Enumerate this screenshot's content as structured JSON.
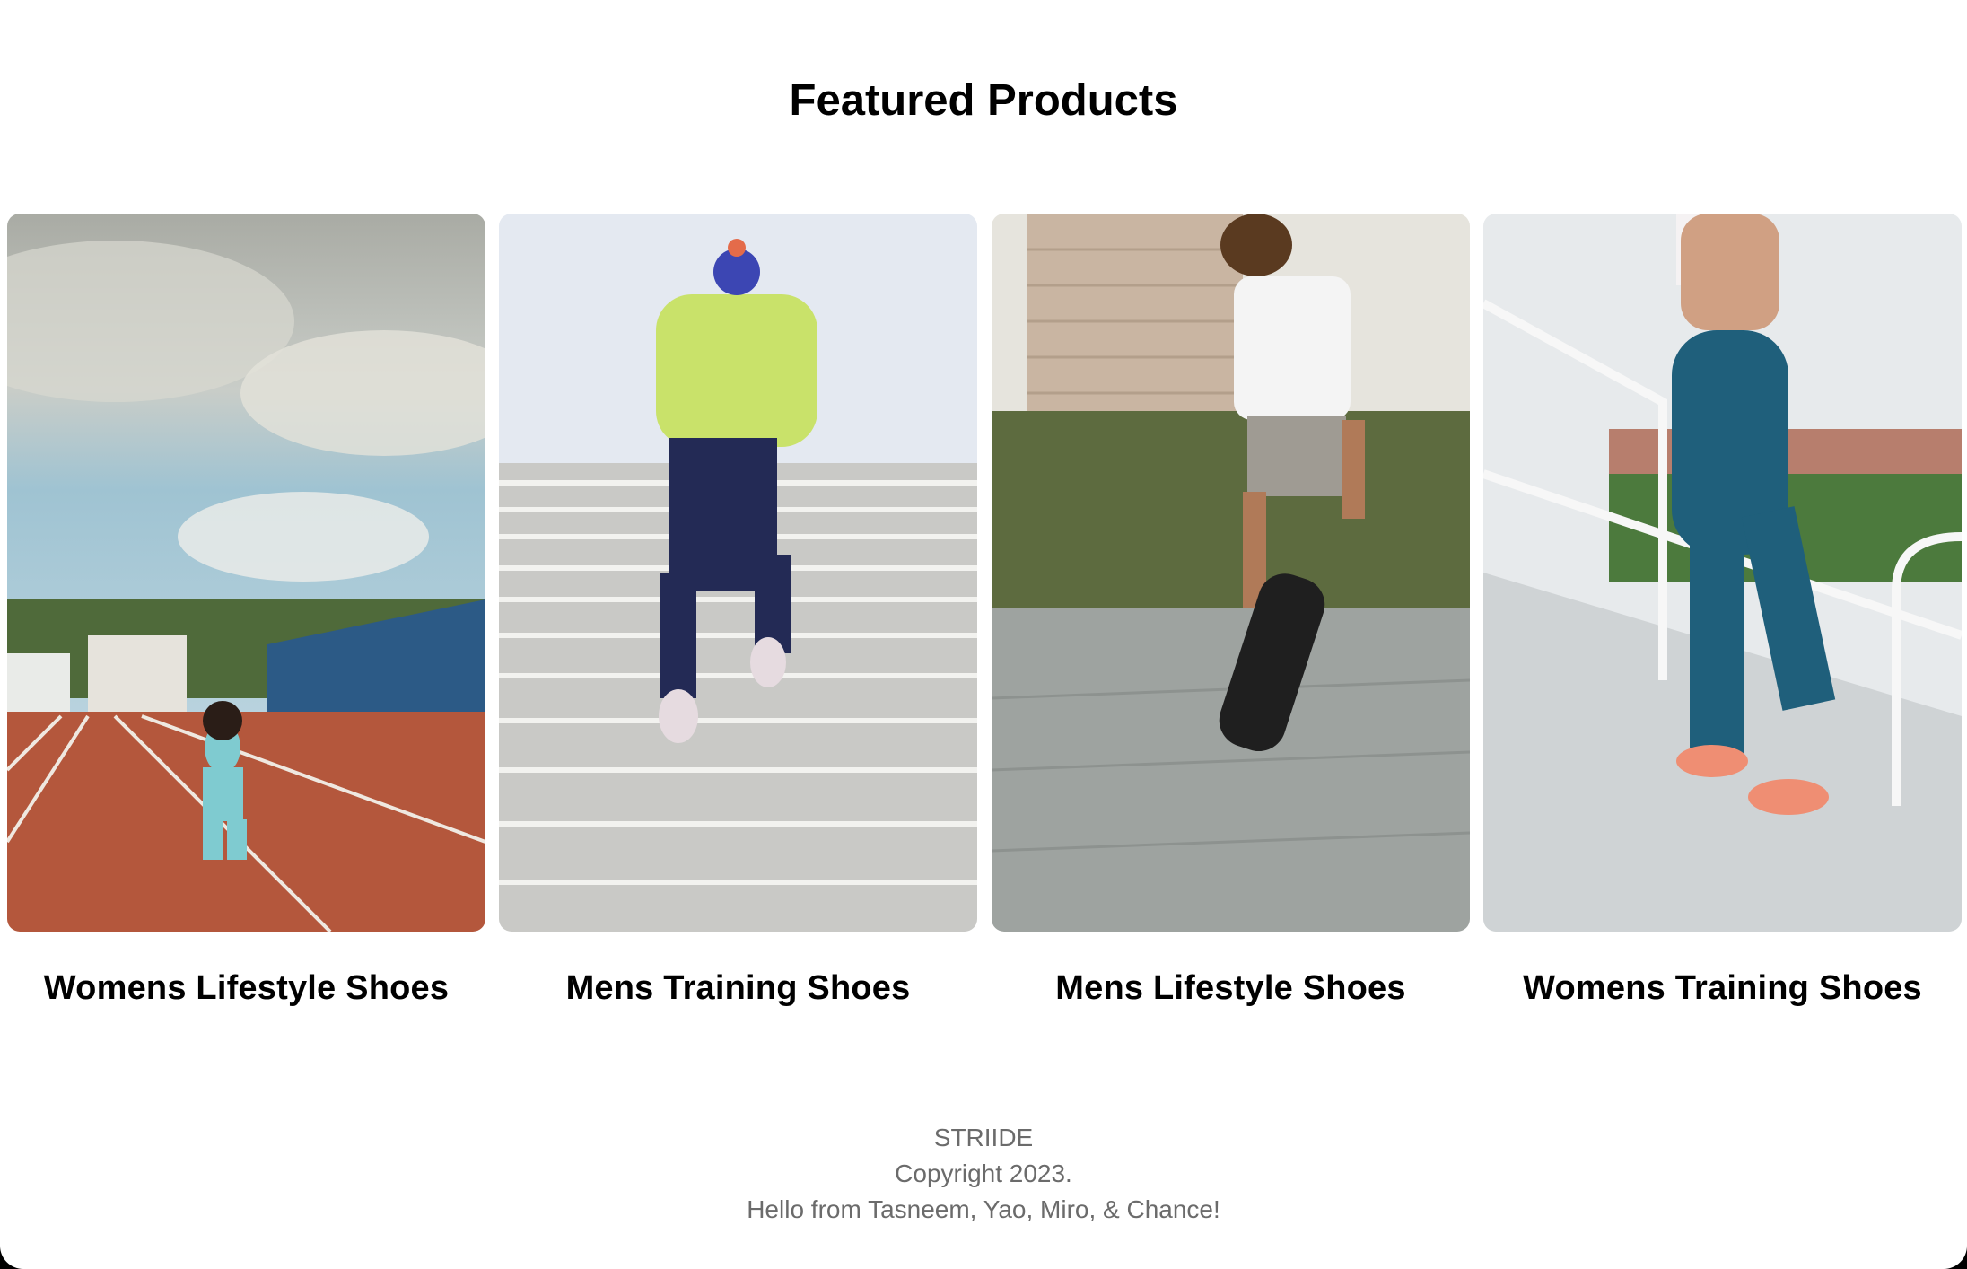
{
  "featured": {
    "title": "Featured Products"
  },
  "products": [
    {
      "label": "Womens Lifestyle Shoes",
      "image": "photo-woman-running-track"
    },
    {
      "label": "Mens Training Shoes",
      "image": "photo-man-running-stairs"
    },
    {
      "label": "Mens Lifestyle Shoes",
      "image": "photo-man-skateboard"
    },
    {
      "label": "Womens Training Shoes",
      "image": "photo-woman-stadium-steps"
    }
  ],
  "footer": {
    "brand": "STRIIDE",
    "copyright": "Copyright 2023.",
    "greeting": "Hello from Tasneem, Yao, Miro, & Chance!"
  }
}
